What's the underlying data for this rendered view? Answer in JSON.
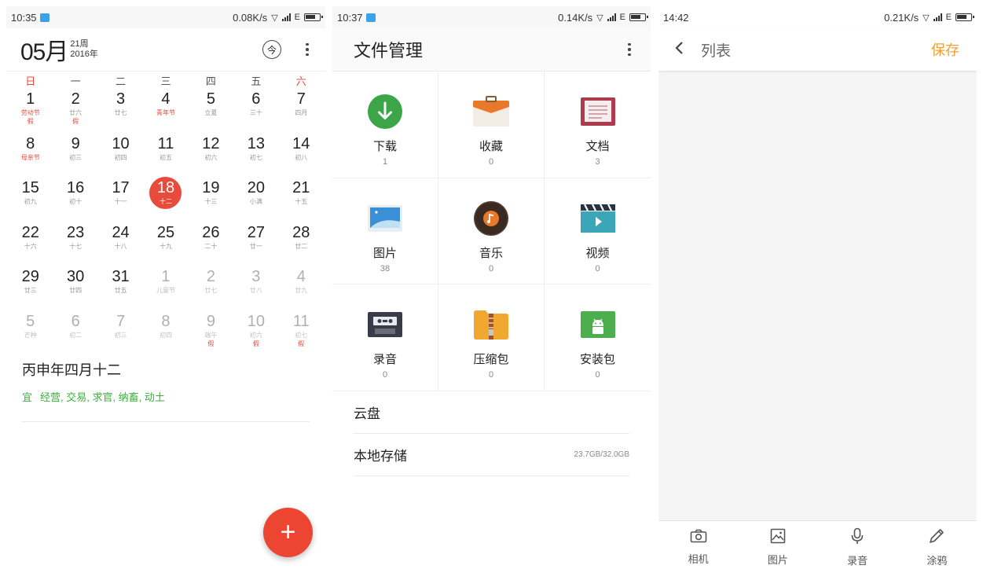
{
  "calendar": {
    "status": {
      "time": "10:35",
      "speed": "0.08K/s",
      "net": "E"
    },
    "month": "05月",
    "week": "21周",
    "year": "2016年",
    "today_icon": "今",
    "weekdays": [
      "日",
      "一",
      "二",
      "三",
      "四",
      "五",
      "六"
    ],
    "days": [
      {
        "num": "1",
        "lunar": "劳动节",
        "badge": "假",
        "lunar_red": true
      },
      {
        "num": "2",
        "lunar": "廿六",
        "badge": "假"
      },
      {
        "num": "3",
        "lunar": "廿七"
      },
      {
        "num": "4",
        "lunar": "青年节",
        "lunar_red": true
      },
      {
        "num": "5",
        "lunar": "立夏"
      },
      {
        "num": "6",
        "lunar": "三十"
      },
      {
        "num": "7",
        "lunar": "四月"
      },
      {
        "num": "8",
        "lunar": "母亲节",
        "lunar_red": true
      },
      {
        "num": "9",
        "lunar": "初三"
      },
      {
        "num": "10",
        "lunar": "初四"
      },
      {
        "num": "11",
        "lunar": "初五"
      },
      {
        "num": "12",
        "lunar": "初六"
      },
      {
        "num": "13",
        "lunar": "初七"
      },
      {
        "num": "14",
        "lunar": "初八"
      },
      {
        "num": "15",
        "lunar": "初九"
      },
      {
        "num": "16",
        "lunar": "初十"
      },
      {
        "num": "17",
        "lunar": "十一"
      },
      {
        "num": "18",
        "lunar": "十二",
        "today": true
      },
      {
        "num": "19",
        "lunar": "十三"
      },
      {
        "num": "20",
        "lunar": "小满"
      },
      {
        "num": "21",
        "lunar": "十五"
      },
      {
        "num": "22",
        "lunar": "十六"
      },
      {
        "num": "23",
        "lunar": "十七"
      },
      {
        "num": "24",
        "lunar": "十八"
      },
      {
        "num": "25",
        "lunar": "十九"
      },
      {
        "num": "26",
        "lunar": "二十"
      },
      {
        "num": "27",
        "lunar": "廿一"
      },
      {
        "num": "28",
        "lunar": "廿二"
      },
      {
        "num": "29",
        "lunar": "廿三"
      },
      {
        "num": "30",
        "lunar": "廿四"
      },
      {
        "num": "31",
        "lunar": "廿五"
      },
      {
        "num": "1",
        "lunar": "儿童节",
        "other": true
      },
      {
        "num": "2",
        "lunar": "廿七",
        "other": true
      },
      {
        "num": "3",
        "lunar": "廿八",
        "other": true
      },
      {
        "num": "4",
        "lunar": "廿九",
        "other": true
      },
      {
        "num": "5",
        "lunar": "芒种",
        "other": true
      },
      {
        "num": "6",
        "lunar": "初二",
        "other": true
      },
      {
        "num": "7",
        "lunar": "初三",
        "other": true
      },
      {
        "num": "8",
        "lunar": "初四",
        "other": true
      },
      {
        "num": "9",
        "lunar": "端午",
        "badge": "假",
        "other": true
      },
      {
        "num": "10",
        "lunar": "初六",
        "badge": "假",
        "other": true
      },
      {
        "num": "11",
        "lunar": "初七",
        "badge": "假",
        "other": true
      }
    ],
    "almanac_title": "丙申年四月十二",
    "yi_label": "宜",
    "yi_text": "经营, 交易, 求官, 纳畜, 动土",
    "fab_label": "+"
  },
  "files": {
    "status": {
      "time": "10:37",
      "speed": "0.14K/s",
      "net": "E"
    },
    "title": "文件管理",
    "categories": [
      {
        "label": "下载",
        "count": "1",
        "icon": "download-icon",
        "color": "#3ca548"
      },
      {
        "label": "收藏",
        "count": "0",
        "icon": "favorites-icon",
        "color": "#e8782a"
      },
      {
        "label": "文档",
        "count": "3",
        "icon": "document-icon",
        "color": "#b03a4e"
      },
      {
        "label": "图片",
        "count": "38",
        "icon": "image-icon",
        "color": "#3a8fd6"
      },
      {
        "label": "音乐",
        "count": "0",
        "icon": "music-icon",
        "color": "#e8782a"
      },
      {
        "label": "视频",
        "count": "0",
        "icon": "video-icon",
        "color": "#3aa6b8"
      },
      {
        "label": "录音",
        "count": "0",
        "icon": "cassette-icon",
        "color": "#3a3a48"
      },
      {
        "label": "压缩包",
        "count": "0",
        "icon": "archive-icon",
        "color": "#f0a830"
      },
      {
        "label": "安装包",
        "count": "0",
        "icon": "apk-icon",
        "color": "#4cae4c"
      }
    ],
    "rows": [
      {
        "label": "云盘",
        "value": ""
      },
      {
        "label": "本地存储",
        "value": "23.7GB/32.0GB"
      }
    ]
  },
  "notes": {
    "status": {
      "time": "14:42",
      "speed": "0.21K/s",
      "net": "E"
    },
    "title": "列表",
    "save_label": "保存",
    "tools": [
      {
        "label": "相机",
        "icon": "camera-icon"
      },
      {
        "label": "图片",
        "icon": "picture-icon"
      },
      {
        "label": "录音",
        "icon": "microphone-icon"
      },
      {
        "label": "涂鸦",
        "icon": "pencil-icon"
      }
    ]
  }
}
